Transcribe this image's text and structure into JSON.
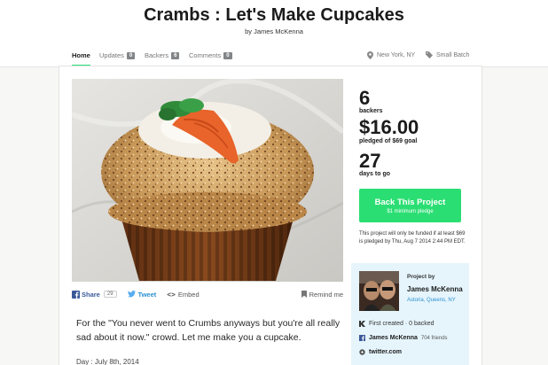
{
  "project": {
    "title": "Crambs : Let's Make Cupcakes",
    "byline_prefix": "by",
    "creator_name": "James McKenna"
  },
  "nav": {
    "tabs": [
      {
        "label": "Home",
        "count": null,
        "active": true
      },
      {
        "label": "Updates",
        "count": "0",
        "active": false
      },
      {
        "label": "Backers",
        "count": "6",
        "active": false
      },
      {
        "label": "Comments",
        "count": "0",
        "active": false
      }
    ],
    "location": "New York, NY",
    "category": "Small Batch"
  },
  "stats": {
    "backers_count": "6",
    "backers_label": "backers",
    "pledged_amount": "$16.00",
    "pledged_label": "pledged of $69 goal",
    "days_count": "27",
    "days_label": "days to go"
  },
  "back_button": {
    "label": "Back This Project",
    "sublabel": "$1 minimum pledge"
  },
  "funding_note": "This project will only be funded if at least $69 is pledged by Thu, Aug 7 2014 2:44 PM EDT.",
  "creator": {
    "heading": "Project by",
    "name": "James McKenna",
    "location": "Astoria, Queens, NY",
    "first_created": "First created · 0 backed",
    "facebook_name": "James McKenna",
    "facebook_friends": "704 friends",
    "website": "twitter.com"
  },
  "share": {
    "facebook_label": "Share",
    "facebook_count": "29",
    "tweet_label": "Tweet",
    "embed_label": "Embed",
    "remind_label": "Remind me"
  },
  "blurb": "For the \"You never went to Crumbs anyways but you're all really sad about it now.\" crowd. Let me make you a cupcake.",
  "day_line": "Day : July 8th, 2014",
  "colors": {
    "accent_green": "#2bde73",
    "link_blue": "#2a90d0",
    "facebook_blue": "#3b5998",
    "twitter_blue": "#55acee",
    "creator_bg": "#e6f5fc"
  },
  "icons": {
    "location": "map-pin-icon",
    "category": "tag-icon",
    "facebook": "facebook-icon",
    "twitter": "twitter-bird-icon",
    "embed": "code-brackets-icon",
    "remind": "bookmark-icon",
    "kickstarter": "kickstarter-k-icon",
    "link": "link-icon"
  }
}
